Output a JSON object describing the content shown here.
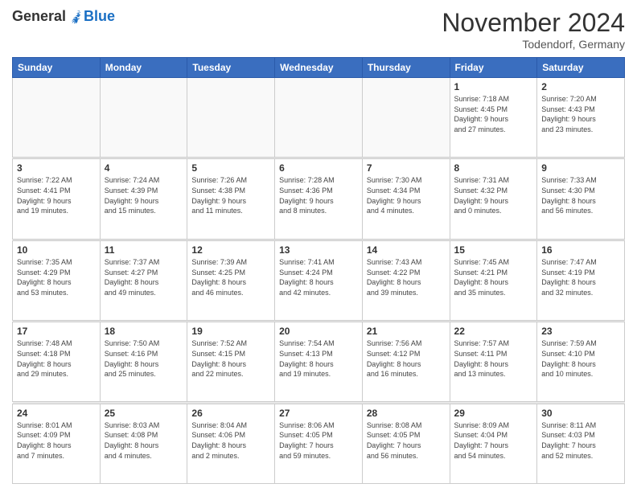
{
  "logo": {
    "general": "General",
    "blue": "Blue"
  },
  "title": "November 2024",
  "location": "Todendorf, Germany",
  "days_of_week": [
    "Sunday",
    "Monday",
    "Tuesday",
    "Wednesday",
    "Thursday",
    "Friday",
    "Saturday"
  ],
  "weeks": [
    [
      {
        "day": "",
        "info": ""
      },
      {
        "day": "",
        "info": ""
      },
      {
        "day": "",
        "info": ""
      },
      {
        "day": "",
        "info": ""
      },
      {
        "day": "",
        "info": ""
      },
      {
        "day": "1",
        "info": "Sunrise: 7:18 AM\nSunset: 4:45 PM\nDaylight: 9 hours\nand 27 minutes."
      },
      {
        "day": "2",
        "info": "Sunrise: 7:20 AM\nSunset: 4:43 PM\nDaylight: 9 hours\nand 23 minutes."
      }
    ],
    [
      {
        "day": "3",
        "info": "Sunrise: 7:22 AM\nSunset: 4:41 PM\nDaylight: 9 hours\nand 19 minutes."
      },
      {
        "day": "4",
        "info": "Sunrise: 7:24 AM\nSunset: 4:39 PM\nDaylight: 9 hours\nand 15 minutes."
      },
      {
        "day": "5",
        "info": "Sunrise: 7:26 AM\nSunset: 4:38 PM\nDaylight: 9 hours\nand 11 minutes."
      },
      {
        "day": "6",
        "info": "Sunrise: 7:28 AM\nSunset: 4:36 PM\nDaylight: 9 hours\nand 8 minutes."
      },
      {
        "day": "7",
        "info": "Sunrise: 7:30 AM\nSunset: 4:34 PM\nDaylight: 9 hours\nand 4 minutes."
      },
      {
        "day": "8",
        "info": "Sunrise: 7:31 AM\nSunset: 4:32 PM\nDaylight: 9 hours\nand 0 minutes."
      },
      {
        "day": "9",
        "info": "Sunrise: 7:33 AM\nSunset: 4:30 PM\nDaylight: 8 hours\nand 56 minutes."
      }
    ],
    [
      {
        "day": "10",
        "info": "Sunrise: 7:35 AM\nSunset: 4:29 PM\nDaylight: 8 hours\nand 53 minutes."
      },
      {
        "day": "11",
        "info": "Sunrise: 7:37 AM\nSunset: 4:27 PM\nDaylight: 8 hours\nand 49 minutes."
      },
      {
        "day": "12",
        "info": "Sunrise: 7:39 AM\nSunset: 4:25 PM\nDaylight: 8 hours\nand 46 minutes."
      },
      {
        "day": "13",
        "info": "Sunrise: 7:41 AM\nSunset: 4:24 PM\nDaylight: 8 hours\nand 42 minutes."
      },
      {
        "day": "14",
        "info": "Sunrise: 7:43 AM\nSunset: 4:22 PM\nDaylight: 8 hours\nand 39 minutes."
      },
      {
        "day": "15",
        "info": "Sunrise: 7:45 AM\nSunset: 4:21 PM\nDaylight: 8 hours\nand 35 minutes."
      },
      {
        "day": "16",
        "info": "Sunrise: 7:47 AM\nSunset: 4:19 PM\nDaylight: 8 hours\nand 32 minutes."
      }
    ],
    [
      {
        "day": "17",
        "info": "Sunrise: 7:48 AM\nSunset: 4:18 PM\nDaylight: 8 hours\nand 29 minutes."
      },
      {
        "day": "18",
        "info": "Sunrise: 7:50 AM\nSunset: 4:16 PM\nDaylight: 8 hours\nand 25 minutes."
      },
      {
        "day": "19",
        "info": "Sunrise: 7:52 AM\nSunset: 4:15 PM\nDaylight: 8 hours\nand 22 minutes."
      },
      {
        "day": "20",
        "info": "Sunrise: 7:54 AM\nSunset: 4:13 PM\nDaylight: 8 hours\nand 19 minutes."
      },
      {
        "day": "21",
        "info": "Sunrise: 7:56 AM\nSunset: 4:12 PM\nDaylight: 8 hours\nand 16 minutes."
      },
      {
        "day": "22",
        "info": "Sunrise: 7:57 AM\nSunset: 4:11 PM\nDaylight: 8 hours\nand 13 minutes."
      },
      {
        "day": "23",
        "info": "Sunrise: 7:59 AM\nSunset: 4:10 PM\nDaylight: 8 hours\nand 10 minutes."
      }
    ],
    [
      {
        "day": "24",
        "info": "Sunrise: 8:01 AM\nSunset: 4:09 PM\nDaylight: 8 hours\nand 7 minutes."
      },
      {
        "day": "25",
        "info": "Sunrise: 8:03 AM\nSunset: 4:08 PM\nDaylight: 8 hours\nand 4 minutes."
      },
      {
        "day": "26",
        "info": "Sunrise: 8:04 AM\nSunset: 4:06 PM\nDaylight: 8 hours\nand 2 minutes."
      },
      {
        "day": "27",
        "info": "Sunrise: 8:06 AM\nSunset: 4:05 PM\nDaylight: 7 hours\nand 59 minutes."
      },
      {
        "day": "28",
        "info": "Sunrise: 8:08 AM\nSunset: 4:05 PM\nDaylight: 7 hours\nand 56 minutes."
      },
      {
        "day": "29",
        "info": "Sunrise: 8:09 AM\nSunset: 4:04 PM\nDaylight: 7 hours\nand 54 minutes."
      },
      {
        "day": "30",
        "info": "Sunrise: 8:11 AM\nSunset: 4:03 PM\nDaylight: 7 hours\nand 52 minutes."
      }
    ]
  ]
}
